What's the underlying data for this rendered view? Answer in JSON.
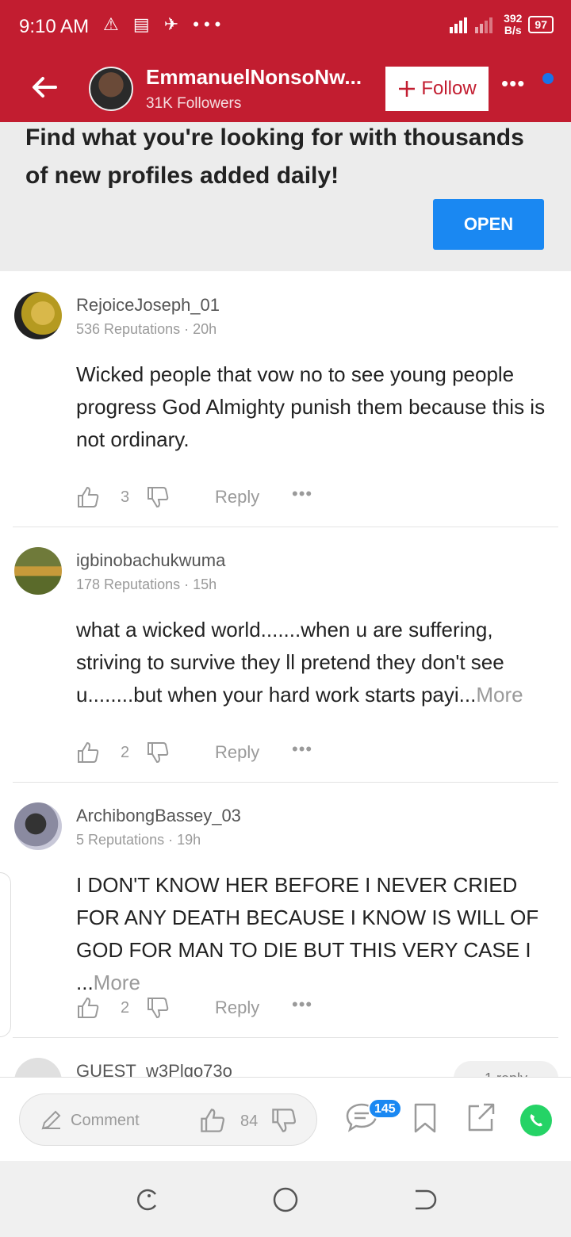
{
  "status_bar": {
    "time": "9:10 AM",
    "notification_icons": "⚠ ▤ ✈ •••",
    "speed_top": "392",
    "speed_bottom": "B/s",
    "battery": "97"
  },
  "header": {
    "name": "EmmanuelNonsoNw...",
    "followers": "31K Followers",
    "follow_label": "Follow",
    "more_label": "•••"
  },
  "ad": {
    "text": "Find what you're looking for with thousands of new profiles added daily!",
    "button": "OPEN"
  },
  "comments": [
    {
      "user": "RejoiceJoseph_01",
      "meta": "536 Reputations · 20h",
      "text": "Wicked people that vow no to see young people progress God Almighty punish them because this is not ordinary.",
      "more": "",
      "likes": "3",
      "reply": "Reply",
      "dots": "•••"
    },
    {
      "user": "igbinobachukwuma",
      "meta": "178 Reputations · 15h",
      "text": "what a wicked world.......when u are suffering, striving to survive they ll pretend they don't see u........but when your hard work starts payi...",
      "more": "More",
      "likes": "2",
      "reply": "Reply",
      "dots": "•••"
    },
    {
      "user": "ArchibongBassey_03",
      "meta": "5 Reputations · 19h",
      "text": "I DON'T KNOW HER BEFORE  I NEVER CRIED FOR ANY DEATH BECAUSE I KNOW IS WILL OF GOD FOR MAN TO DIE BUT THIS VERY CASE I ...",
      "more": "More",
      "likes": "2",
      "reply": "Reply",
      "dots": "•••"
    },
    {
      "user": "GUEST_w3Plgo73o",
      "reply_count": "1 reply"
    }
  ],
  "toolbar": {
    "comment_placeholder": "Comment",
    "likes": "84",
    "comments_badge": "145"
  },
  "colors": {
    "brand_red": "#c21d30",
    "accent_blue": "#1a88f2",
    "whatsapp_green": "#25d366"
  }
}
